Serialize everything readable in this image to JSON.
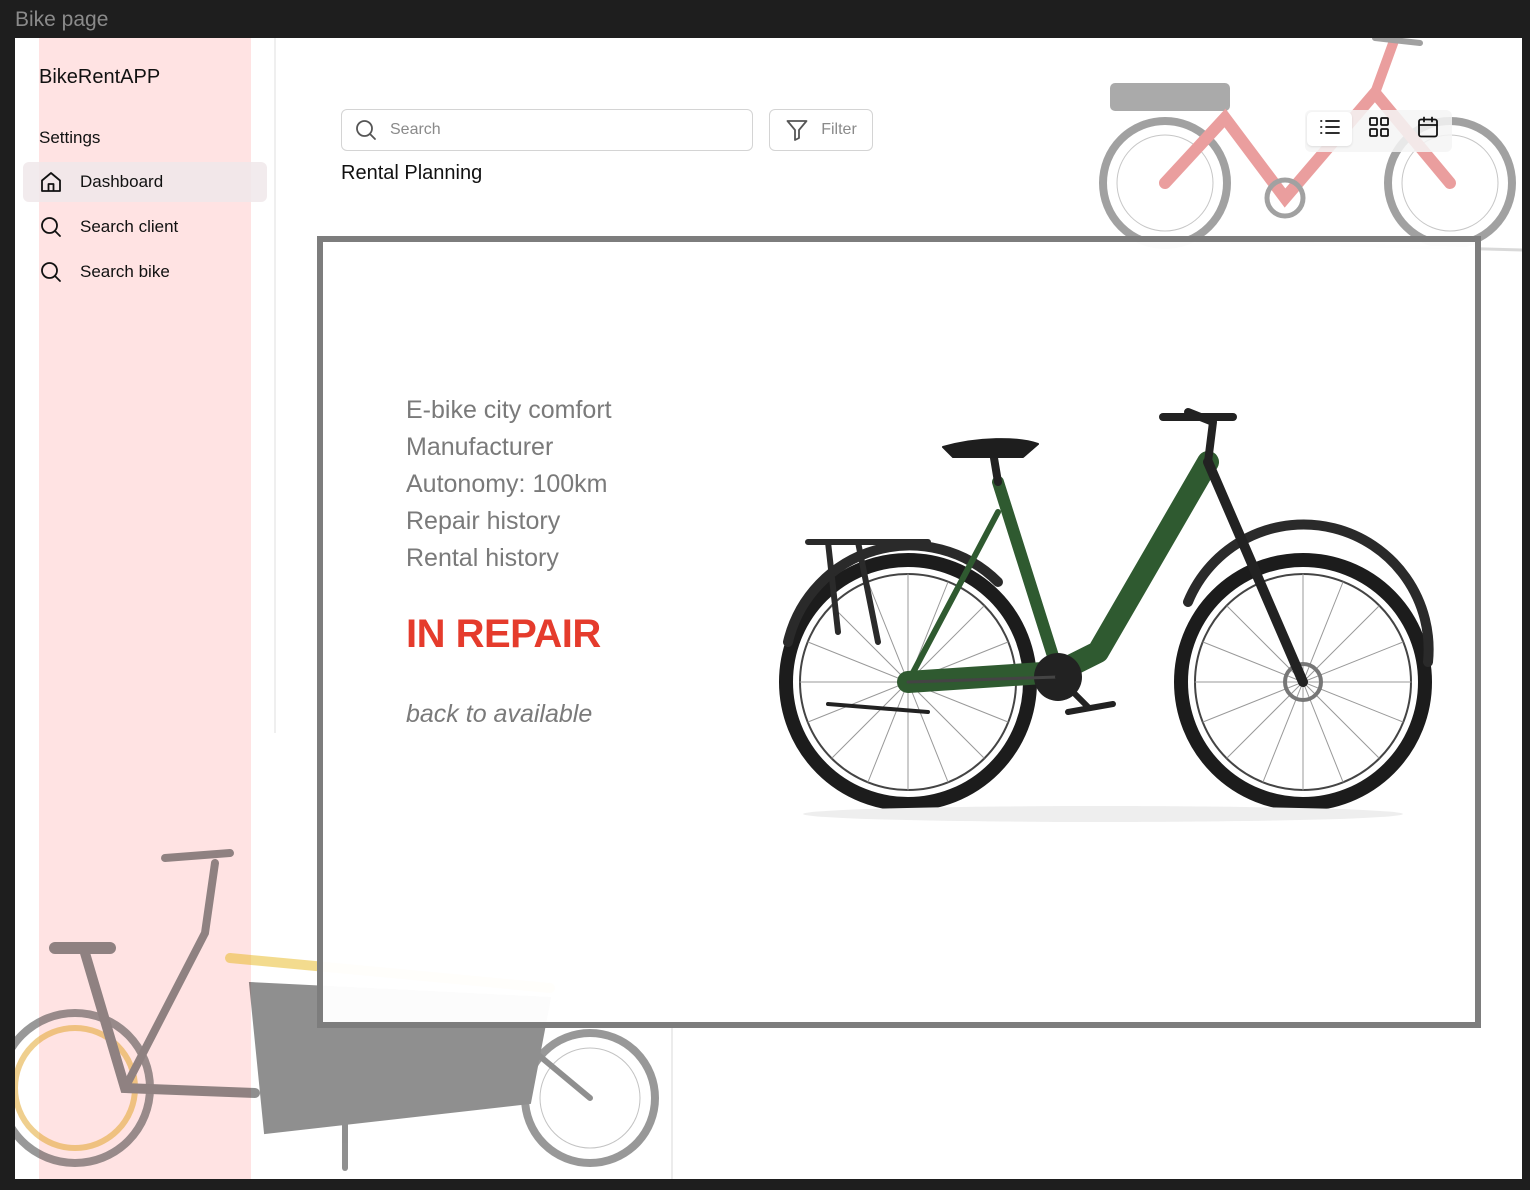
{
  "frame": {
    "label": "Bike page"
  },
  "app": {
    "title": "BikeRentAPP"
  },
  "sidebar": {
    "section_label": "Settings",
    "items": [
      {
        "label": "Dashboard",
        "icon": "home-icon",
        "active": true
      },
      {
        "label": "Search client",
        "icon": "search-icon",
        "active": false
      },
      {
        "label": "Search bike",
        "icon": "search-icon",
        "active": false
      }
    ]
  },
  "toolbar": {
    "search_placeholder": "Search",
    "filter_label": "Filter",
    "views": [
      "list-view-icon",
      "grid-view-icon",
      "calendar-view-icon"
    ]
  },
  "page": {
    "title": "Rental Planning"
  },
  "bike": {
    "details": [
      "E-bike city comfort",
      "Manufacturer",
      "Autonomy: 100km",
      "Repair history",
      "Rental history"
    ],
    "status": "IN REPAIR",
    "back_action": "back to available",
    "frame_color": "#2f5a30"
  },
  "colors": {
    "status": "#e53b2c",
    "sidebar_highlight": "#ffe3e3",
    "card_border": "#7d7d7d",
    "background_bike_accent": "#e06a6a"
  }
}
